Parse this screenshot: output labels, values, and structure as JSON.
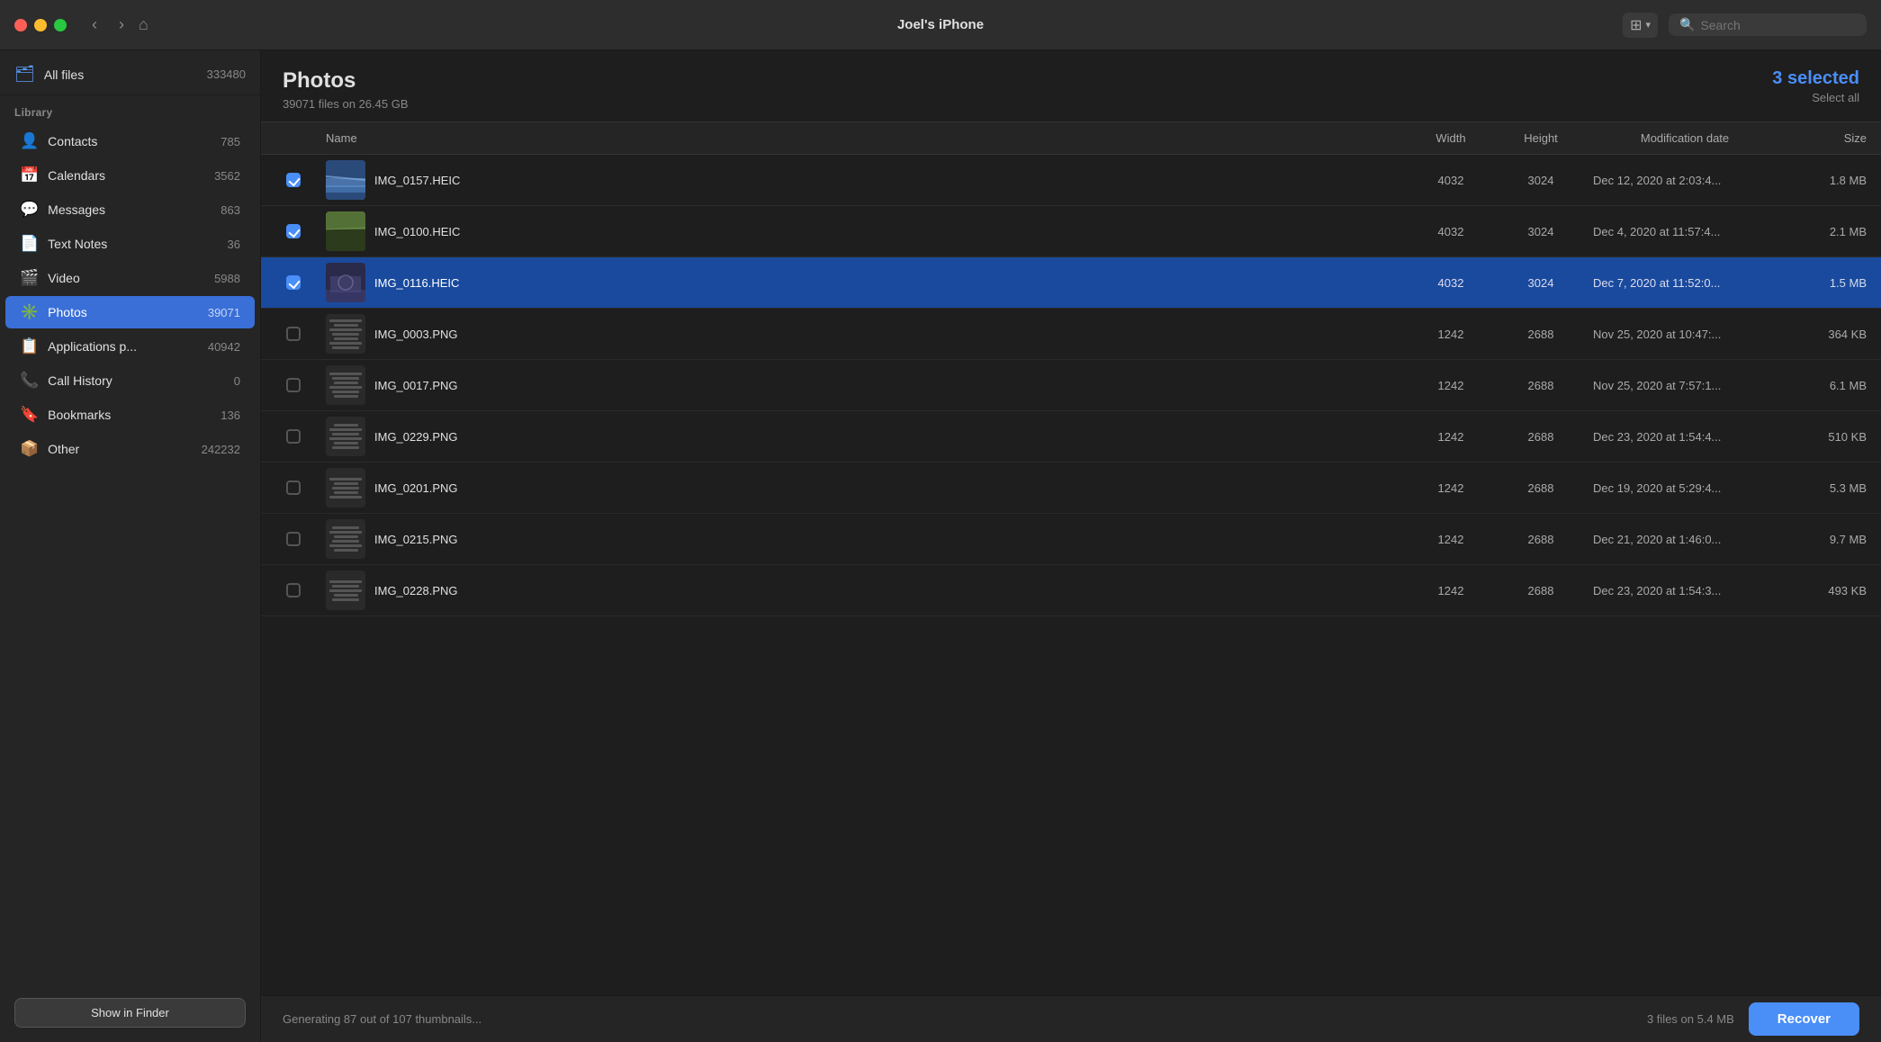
{
  "titlebar": {
    "title": "Joel's iPhone",
    "search_placeholder": "Search"
  },
  "sidebar": {
    "all_files_label": "All files",
    "all_files_count": "333480",
    "section_label": "Library",
    "items": [
      {
        "id": "contacts",
        "label": "Contacts",
        "count": "785",
        "icon": "👤"
      },
      {
        "id": "calendars",
        "label": "Calendars",
        "count": "3562",
        "icon": "📅"
      },
      {
        "id": "messages",
        "label": "Messages",
        "count": "863",
        "icon": "💬"
      },
      {
        "id": "text-notes",
        "label": "Text Notes",
        "count": "36",
        "icon": "📄"
      },
      {
        "id": "video",
        "label": "Video",
        "count": "5988",
        "icon": "🎬"
      },
      {
        "id": "photos",
        "label": "Photos",
        "count": "39071",
        "icon": "✳️",
        "active": true
      },
      {
        "id": "applications",
        "label": "Applications p...",
        "count": "40942",
        "icon": "📋"
      },
      {
        "id": "call-history",
        "label": "Call History",
        "count": "0",
        "icon": "📞"
      },
      {
        "id": "bookmarks",
        "label": "Bookmarks",
        "count": "136",
        "icon": "🔖"
      },
      {
        "id": "other",
        "label": "Other",
        "count": "242232",
        "icon": "📦"
      }
    ],
    "show_in_finder": "Show in Finder"
  },
  "content": {
    "title": "Photos",
    "subtitle": "39071 files on 26.45 GB",
    "selected_count": "3 selected",
    "select_all": "Select all",
    "columns": {
      "name": "Name",
      "width": "Width",
      "height": "Height",
      "modification_date": "Modification date",
      "size": "Size"
    },
    "files": [
      {
        "id": "img0157",
        "name": "IMG_0157.HEIC",
        "width": "4032",
        "height": "3024",
        "modification_date": "Dec 12, 2020 at 2:03:4...",
        "size": "1.8 MB",
        "checked": true,
        "selected": true,
        "thumb_type": "heic1"
      },
      {
        "id": "img0100",
        "name": "IMG_0100.HEIC",
        "width": "4032",
        "height": "3024",
        "modification_date": "Dec 4, 2020 at 11:57:4...",
        "size": "2.1 MB",
        "checked": true,
        "selected": false,
        "thumb_type": "heic2"
      },
      {
        "id": "img0116",
        "name": "IMG_0116.HEIC",
        "width": "4032",
        "height": "3024",
        "modification_date": "Dec 7, 2020 at 11:52:0...",
        "size": "1.5 MB",
        "checked": true,
        "selected": true,
        "thumb_type": "heic3"
      },
      {
        "id": "img0003",
        "name": "IMG_0003.PNG",
        "width": "1242",
        "height": "2688",
        "modification_date": "Nov 25, 2020 at 10:47:...",
        "size": "364 KB",
        "checked": false,
        "selected": false,
        "thumb_type": "png"
      },
      {
        "id": "img0017",
        "name": "IMG_0017.PNG",
        "width": "1242",
        "height": "2688",
        "modification_date": "Nov 25, 2020 at 7:57:1...",
        "size": "6.1 MB",
        "checked": false,
        "selected": false,
        "thumb_type": "png"
      },
      {
        "id": "img0229",
        "name": "IMG_0229.PNG",
        "width": "1242",
        "height": "2688",
        "modification_date": "Dec 23, 2020 at 1:54:4...",
        "size": "510 KB",
        "checked": false,
        "selected": false,
        "thumb_type": "png"
      },
      {
        "id": "img0201",
        "name": "IMG_0201.PNG",
        "width": "1242",
        "height": "2688",
        "modification_date": "Dec 19, 2020 at 5:29:4...",
        "size": "5.3 MB",
        "checked": false,
        "selected": false,
        "thumb_type": "png"
      },
      {
        "id": "img0215",
        "name": "IMG_0215.PNG",
        "width": "1242",
        "height": "2688",
        "modification_date": "Dec 21, 2020 at 1:46:0...",
        "size": "9.7 MB",
        "checked": false,
        "selected": false,
        "thumb_type": "png"
      },
      {
        "id": "img0228",
        "name": "IMG_0228.PNG",
        "width": "1242",
        "height": "2688",
        "modification_date": "Dec 23, 2020 at 1:54:3...",
        "size": "493 KB",
        "checked": false,
        "selected": false,
        "thumb_type": "png"
      }
    ]
  },
  "statusbar": {
    "generating_text": "Generating 87 out of 107 thumbnails...",
    "files_size": "3 files on 5.4 MB",
    "recover_label": "Recover"
  }
}
